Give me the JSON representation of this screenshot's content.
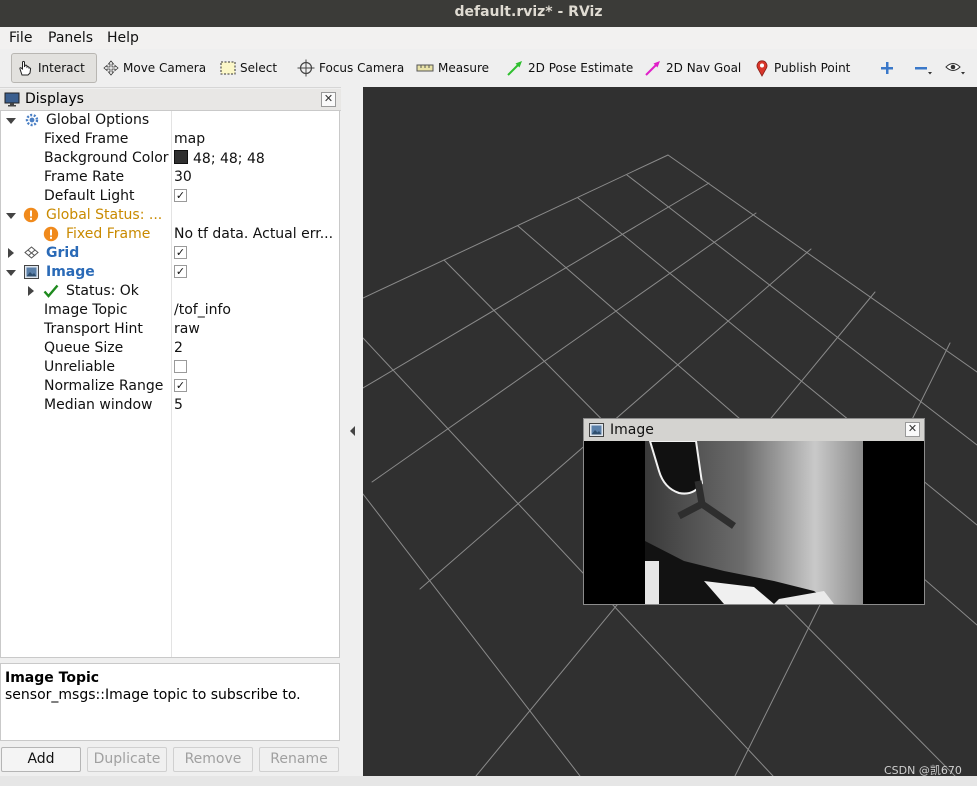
{
  "window": {
    "title": "default.rviz* - RViz"
  },
  "menu": [
    {
      "label": "File"
    },
    {
      "label": "Panels"
    },
    {
      "label": "Help"
    }
  ],
  "toolbar": {
    "interact": "Interact",
    "move_camera": "Move Camera",
    "select": "Select",
    "focus_camera": "Focus Camera",
    "measure": "Measure",
    "pose_estimate": "2D Pose Estimate",
    "nav_goal": "2D Nav Goal",
    "publish_point": "Publish Point"
  },
  "displays_panel": {
    "title": "Displays",
    "tree": {
      "global_options": {
        "label": "Global Options"
      },
      "fixed_frame": {
        "label": "Fixed Frame",
        "value": "map"
      },
      "background_color": {
        "label": "Background Color",
        "value": "48; 48; 48",
        "color": "#303030"
      },
      "frame_rate": {
        "label": "Frame Rate",
        "value": "30"
      },
      "default_light": {
        "label": "Default Light",
        "checked": true
      },
      "global_status": {
        "label": "Global Status: ..."
      },
      "fixed_frame_status": {
        "label": "Fixed Frame",
        "value": "No tf data.  Actual err..."
      },
      "grid": {
        "label": "Grid",
        "checked": true
      },
      "image": {
        "label": "Image",
        "checked": true
      },
      "status_ok": {
        "label": "Status: Ok"
      },
      "image_topic": {
        "label": "Image Topic",
        "value": "/tof_info"
      },
      "transport_hint": {
        "label": "Transport Hint",
        "value": "raw"
      },
      "queue_size": {
        "label": "Queue Size",
        "value": "2"
      },
      "unreliable": {
        "label": "Unreliable",
        "checked": false
      },
      "normalize_range": {
        "label": "Normalize Range",
        "checked": true
      },
      "median_window": {
        "label": "Median window",
        "value": "5"
      }
    },
    "description": {
      "title": "Image Topic",
      "body": "sensor_msgs::Image topic to subscribe to."
    },
    "buttons": {
      "add": "Add",
      "duplicate": "Duplicate",
      "remove": "Remove",
      "rename": "Rename"
    }
  },
  "image_window": {
    "title": "Image"
  },
  "watermark": "CSDN @凯670",
  "colors": {
    "viewport_bg": "#303030",
    "grid_line": "#a0a0a0",
    "warning": "#c98a00",
    "link_blue": "#2a6ab7"
  }
}
